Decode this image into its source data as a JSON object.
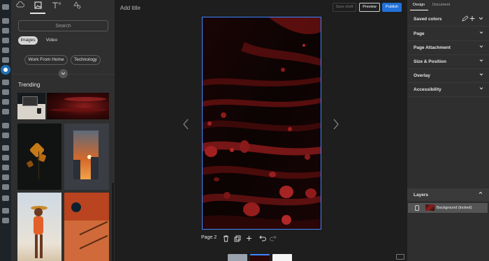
{
  "library": {
    "tabs": [
      {
        "name": "upload",
        "icon": "cloud-upload-icon"
      },
      {
        "name": "media",
        "icon": "image-icon"
      },
      {
        "name": "text",
        "icon": "text-icon"
      },
      {
        "name": "shapes",
        "icon": "shapes-icon"
      }
    ],
    "search_placeholder": "Search",
    "media_types": [
      "Images",
      "Video"
    ],
    "selected_media_type": "Images",
    "categories": [
      "Work From Home",
      "Technology"
    ],
    "section_title": "Trending"
  },
  "editor": {
    "title_placeholder": "Add title",
    "buttons": {
      "save_draft": "Save draft",
      "preview": "Preview",
      "publish": "Publish"
    },
    "page_label": "Page 2",
    "colors": {
      "accent": "#2271d8",
      "selection": "#3a86ff",
      "panel": "#2f2f2f",
      "canvas": "#1e1e1e"
    }
  },
  "design_panel": {
    "tabs": [
      "Design",
      "Document"
    ],
    "active_tab": "Design",
    "sections": [
      "Saved colors",
      "Page",
      "Page Attachment",
      "Size & Position",
      "Overlay",
      "Accessibility"
    ],
    "layers_title": "Layers",
    "layers": [
      {
        "label": "Background (locked)",
        "locked": true
      }
    ]
  }
}
